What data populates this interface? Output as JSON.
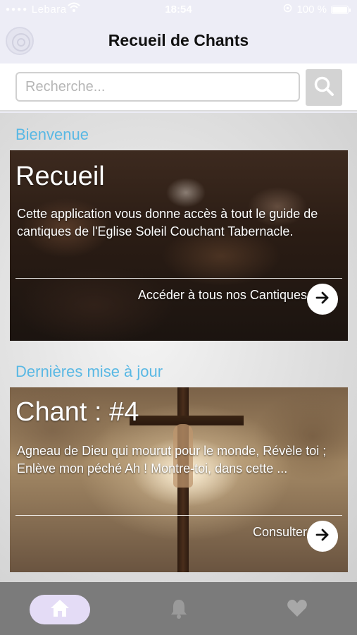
{
  "status": {
    "carrier": "Lebara",
    "time": "18:54",
    "battery": "100 %"
  },
  "header": {
    "title": "Recueil de Chants",
    "logo_icon": "circle-logo-icon"
  },
  "search": {
    "placeholder": "Recherche...",
    "value": "",
    "button_icon": "search-icon"
  },
  "welcome": {
    "section_title": "Bienvenue",
    "card_title": "Recueil",
    "description": "Cette application vous donne accès à tout le guide de cantiques de l'Eglise Soleil Couchant Tabernacle.",
    "link_label": "Accéder à tous nos Cantiques",
    "link_icon": "arrow-right-icon"
  },
  "latest": {
    "section_title": "Dernières mise à jour",
    "card_title": "Chant : #4",
    "description": "Agneau de Dieu qui mourut pour le monde, Révèle toi ; Enlève mon péché  Ah ! Montre-toi, dans cette ...",
    "link_label": "Consulter",
    "link_icon": "arrow-right-icon"
  },
  "tabs": [
    {
      "icon": "home-icon",
      "active": true
    },
    {
      "icon": "bell-icon",
      "active": false
    },
    {
      "icon": "heart-icon",
      "active": false
    }
  ],
  "colors": {
    "accent": "#59b8e4",
    "header_bg": "#ededf6",
    "tabbar_bg": "#7b7b7b",
    "active_tab_bg": "#e4dcf6"
  }
}
